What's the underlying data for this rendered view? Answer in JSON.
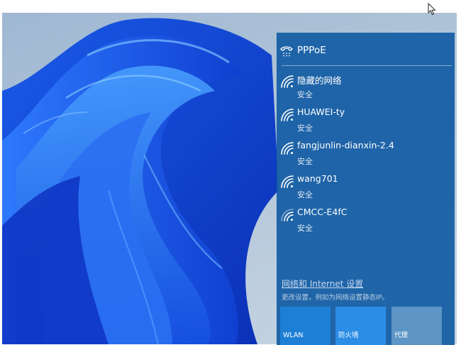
{
  "flyout": {
    "pppoe": {
      "label": "PPPoE",
      "icon": "dialup-phone-icon"
    },
    "networks": [
      {
        "name": "隐藏的网络",
        "status": "安全",
        "icon": "wifi-icon"
      },
      {
        "name": "HUAWEI-ty",
        "status": "安全",
        "icon": "wifi-icon"
      },
      {
        "name": "fangjunlin-dianxin-2.4",
        "status": "安全",
        "icon": "wifi-icon"
      },
      {
        "name": "wang701",
        "status": "安全",
        "icon": "wifi-icon"
      },
      {
        "name": "CMCC-E4fC",
        "status": "安全",
        "icon": "wifi-weak-icon"
      }
    ],
    "settings_link": "网络和 Internet 设置",
    "settings_desc": "更改设置，例如为网络设置静态IP。",
    "tiles": [
      {
        "label": "WLAN"
      },
      {
        "label": "防火墙"
      },
      {
        "label": "代理"
      }
    ]
  },
  "colors": {
    "flyout_bg": "#135ca4",
    "tile_wlan": "#1d7fd6",
    "tile_firewall": "#2b8de6",
    "tile_proxy": "#5c95c6"
  }
}
